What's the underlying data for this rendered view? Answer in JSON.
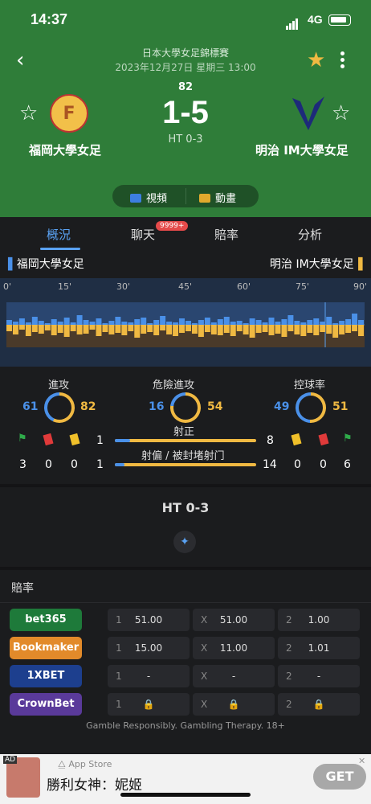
{
  "status": {
    "time": "14:37",
    "network": "4G"
  },
  "match": {
    "league": "日本大學女足錦標賽",
    "datetime": "2023年12月27日 星期三 13:00",
    "minute": "82",
    "score": "1-5",
    "halftime": "HT 0-3",
    "home": "福岡大學女足",
    "away": "明治 IM大學女足"
  },
  "buttons": {
    "video": "視頻",
    "animation": "動畫"
  },
  "tabs": {
    "overview": "概況",
    "chat": "聊天",
    "chat_badge": "9999+",
    "odds": "賠率",
    "analysis": "分析"
  },
  "timeline": {
    "marks": [
      "0'",
      "15'",
      "30'",
      "45'",
      "60'",
      "75'",
      "90'"
    ]
  },
  "stats": {
    "attack_label": "進攻",
    "danger_label": "危險進攻",
    "possession_label": "控球率",
    "attack_home": "61",
    "attack_away": "82",
    "danger_home": "16",
    "danger_away": "54",
    "poss_home": "49",
    "poss_away": "51",
    "shots_on_label": "射正",
    "shots_on_home": "1",
    "shots_on_away": "8",
    "shots_off_label": "射偏 / 被封堵射门",
    "shots_off_home": "1",
    "shots_off_away": "14",
    "home_corners": "3",
    "home_red": "0",
    "home_yellow": "0",
    "away_yellow": "0",
    "away_red": "0",
    "away_corners": "6"
  },
  "halftime_section": {
    "label": "HT 0-3"
  },
  "odds": {
    "title": "賠率",
    "rows": [
      {
        "book": "bet365",
        "c1": "1",
        "v1": "51.00",
        "c2": "X",
        "v2": "51.00",
        "c3": "2",
        "v3": "1.00",
        "color": "#1e7a3a"
      },
      {
        "book": "Bookmaker",
        "c1": "1",
        "v1": "15.00",
        "c2": "X",
        "v2": "11.00",
        "c3": "2",
        "v3": "1.01",
        "color": "#e28a2a"
      },
      {
        "book": "1XBET",
        "c1": "1",
        "v1": "-",
        "c2": "X",
        "v2": "-",
        "c3": "2",
        "v3": "-",
        "color": "#1d3f8e"
      },
      {
        "book": "CrownBet",
        "c1": "1",
        "v1": "",
        "c2": "X",
        "v2": "",
        "c3": "2",
        "v3": "",
        "color": "#5a3a9a"
      }
    ],
    "disclaimer": "Gamble Responsibly. Gambling Therapy. 18+"
  },
  "ad": {
    "tag": "AD",
    "store": "App Store",
    "name": "勝利女神：妮姬",
    "cta": "GET"
  }
}
